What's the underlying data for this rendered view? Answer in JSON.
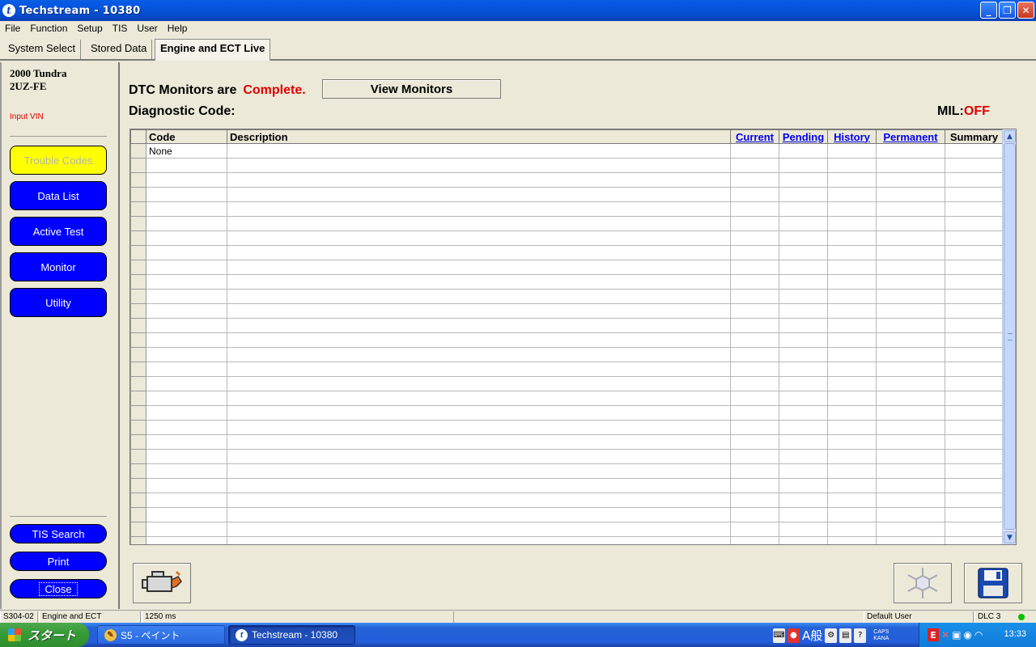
{
  "window": {
    "title": "Techstream - 10380"
  },
  "menu": [
    "File",
    "Function",
    "Setup",
    "TIS",
    "User",
    "Help"
  ],
  "tabs": [
    "System Select",
    "Stored Data",
    "Engine and ECT Live"
  ],
  "sidebar": {
    "vehicle_model": "2000 Tundra",
    "engine_code": "2UZ-FE",
    "input_vin": "Input VIN",
    "buttons": [
      "Trouble Codes",
      "Data List",
      "Active Test",
      "Monitor",
      "Utility"
    ],
    "bottom_buttons": [
      "TIS Search",
      "Print",
      "Close"
    ]
  },
  "main": {
    "dtc_prefix": "DTC Monitors are",
    "dtc_status": "Complete.",
    "view_monitors": "View Monitors",
    "diagnostic_code_label": "Diagnostic Code:",
    "mil_label": "MIL:",
    "mil_status": "OFF",
    "table": {
      "headers": [
        "Code",
        "Description",
        "Current",
        "Pending",
        "History",
        "Permanent",
        "Summary"
      ],
      "rows": [
        [
          "None",
          "",
          "",
          "",
          "",
          "",
          ""
        ]
      ]
    }
  },
  "statusbar": [
    "S304-02",
    "Engine and ECT",
    "1250 ms",
    "Default User",
    "DLC 3"
  ],
  "taskbar": {
    "start": "スタート",
    "tasks": [
      "S5 - ペイント",
      "Techstream - 10380"
    ],
    "tray_caps": "CAPS",
    "tray_kana": "KANA",
    "clock": "13:33"
  },
  "colors": {
    "accent": "#0000ff",
    "active_button": "#ffff00",
    "alert": "#e00000",
    "status_ok": "#00c000"
  }
}
